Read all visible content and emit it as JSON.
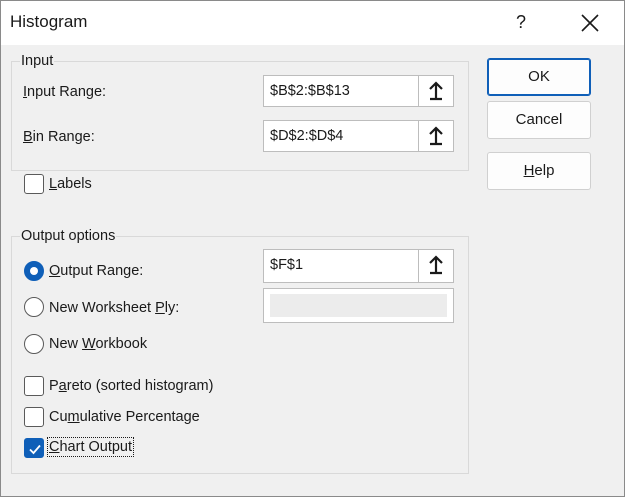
{
  "window": {
    "title": "Histogram",
    "help_glyph": "?"
  },
  "input_group": {
    "legend": "Input",
    "input_range": {
      "label_u": "I",
      "label_rest": "nput Range:",
      "value": "$B$2:$B$13"
    },
    "bin_range": {
      "label_u": "B",
      "label_rest": "in Range:",
      "value": "$D$2:$D$4"
    },
    "labels": {
      "label_u": "L",
      "label_rest": "abels",
      "checked": false
    }
  },
  "output_group": {
    "legend": "Output options",
    "output_range": {
      "label_u": "O",
      "label_rest": "utput Range:",
      "value": "$F$1",
      "selected": true
    },
    "new_worksheet": {
      "label_pre": "New Worksheet ",
      "label_u": "P",
      "label_rest": "ly:",
      "selected": false,
      "value": ""
    },
    "new_workbook": {
      "label_pre": "New ",
      "label_u": "W",
      "label_rest": "orkbook",
      "selected": false
    },
    "pareto": {
      "label_pre": "P",
      "label_u": "a",
      "label_rest": "reto (sorted histogram)",
      "checked": false
    },
    "cumulative": {
      "label_pre": "Cu",
      "label_u": "m",
      "label_rest": "ulative Percentage",
      "checked": false
    },
    "chart_output": {
      "label_u": "C",
      "label_rest": "hart Output",
      "checked": true
    }
  },
  "buttons": {
    "ok": "OK",
    "cancel": "Cancel",
    "help_u": "H",
    "help_rest": "elp"
  },
  "icons": {
    "ref_button": "arrow-up-icon",
    "close": "close-icon",
    "check": "checkmark-icon"
  },
  "colors": {
    "accent": "#0f5fb8",
    "dialog_bg": "#f0f0f0",
    "title_bg": "#ffffff"
  }
}
